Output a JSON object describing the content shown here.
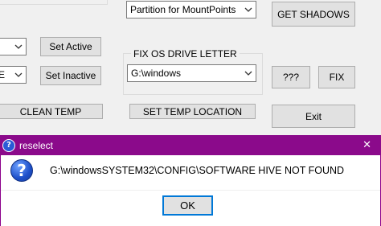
{
  "app": {
    "partition_select_value": "Partition for MountPoints",
    "get_shadows_label": "GET SHADOWS",
    "fix_os_group_label": "FIX OS DRIVE LETTER",
    "drive_select_value": "G:\\windows",
    "qqq_label": "???",
    "fix_label": "FIX",
    "set_active_label": "Set Active",
    "set_inactive_label": "Set Inactive",
    "left_combo_partial_value": "E",
    "clean_temp_label": "CLEAN TEMP",
    "set_temp_location_label": "SET TEMP LOCATION",
    "exit_label": "Exit"
  },
  "dialog": {
    "title": "reselect",
    "message": "G:\\windowsSYSTEM32\\CONFIG\\SOFTWARE HIVE NOT FOUND",
    "ok_label": "OK",
    "close_glyph": "✕"
  },
  "colors": {
    "titlebar": "#8b0a8b",
    "window_bg": "#f0f0f0",
    "button_bg": "#e1e1e1"
  }
}
